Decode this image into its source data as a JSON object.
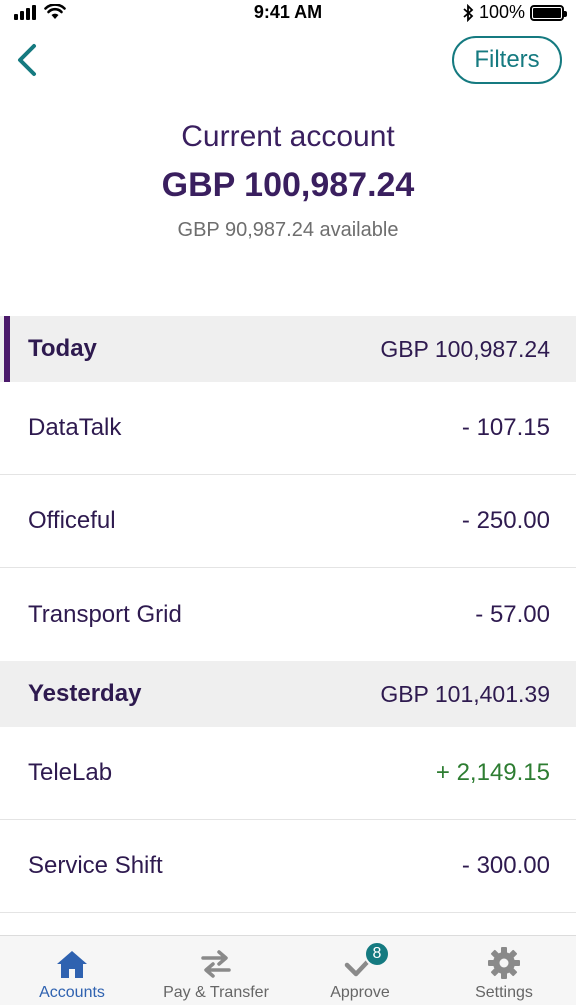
{
  "status_bar": {
    "time": "9:41 AM",
    "battery": "100%"
  },
  "nav": {
    "filters_label": "Filters"
  },
  "account": {
    "name": "Current account",
    "balance": "GBP 100,987.24",
    "available": "GBP 90,987.24 available"
  },
  "sections": [
    {
      "title": "Today",
      "total": "GBP 100,987.24",
      "transactions": [
        {
          "payee": "DataTalk",
          "amount": "- 107.15"
        },
        {
          "payee": "Officeful",
          "amount": "- 250.00"
        },
        {
          "payee": "Transport Grid",
          "amount": "- 57.00"
        }
      ]
    },
    {
      "title": "Yesterday",
      "total": "GBP 101,401.39",
      "transactions": [
        {
          "payee": "TeleLab",
          "amount": "+ 2,149.15"
        },
        {
          "payee": "Service Shift",
          "amount": "- 300.00"
        }
      ]
    }
  ],
  "tabs": [
    {
      "label": "Accounts",
      "icon": "home-icon"
    },
    {
      "label": "Pay & Transfer",
      "icon": "transfer-icon"
    },
    {
      "label": "Approve",
      "icon": "checkmark-icon",
      "badge": "8"
    },
    {
      "label": "Settings",
      "icon": "gear-icon"
    }
  ],
  "colors": {
    "brand_purple": "#3a1f5f",
    "accent_teal": "#157a80",
    "positive_green": "#2e7d32",
    "active_tab_blue": "#2f62b0"
  }
}
